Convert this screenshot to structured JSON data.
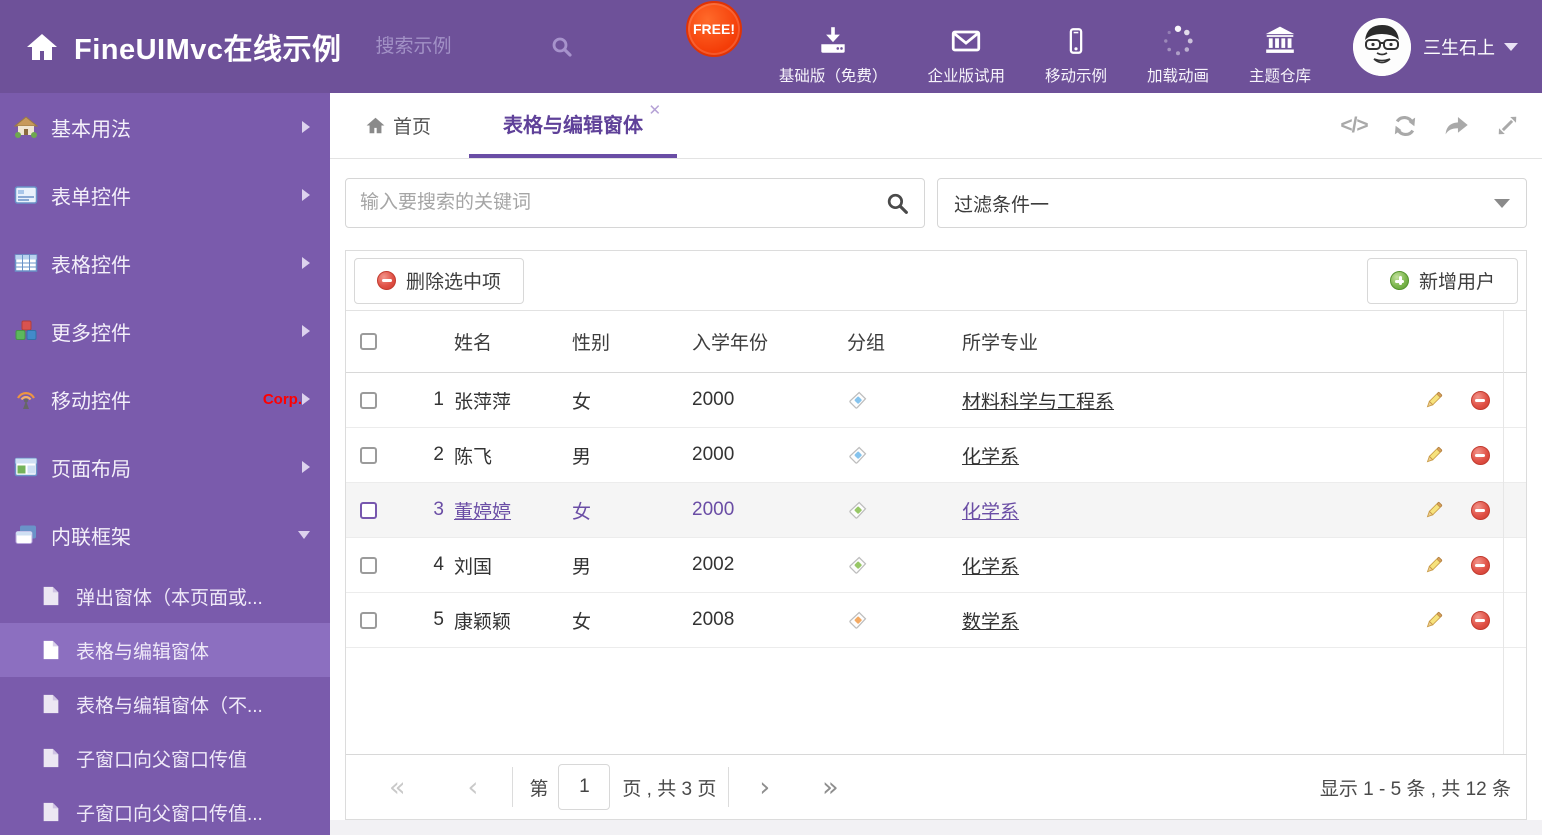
{
  "header": {
    "title": "FineUIMvc在线示例",
    "search_placeholder": "搜索示例",
    "free_badge": "FREE!",
    "nav": [
      {
        "label": "基础版（免费）",
        "icon": "download-icon"
      },
      {
        "label": "企业版试用",
        "icon": "envelope-icon"
      },
      {
        "label": "移动示例",
        "icon": "mobile-icon"
      },
      {
        "label": "加载动画",
        "icon": "spinner-icon"
      },
      {
        "label": "主题仓库",
        "icon": "bank-icon"
      }
    ],
    "user_name": "三生石上"
  },
  "sidebar": {
    "items": [
      {
        "label": "基本用法",
        "icon": "house-icon"
      },
      {
        "label": "表单控件",
        "icon": "form-icon"
      },
      {
        "label": "表格控件",
        "icon": "table-icon"
      },
      {
        "label": "更多控件",
        "icon": "cubes-icon"
      },
      {
        "label": "移动控件",
        "icon": "antenna-icon",
        "badge": "Corp."
      },
      {
        "label": "页面布局",
        "icon": "layout-icon"
      },
      {
        "label": "内联框架",
        "icon": "frames-icon"
      }
    ],
    "subitems": [
      "弹出窗体（本页面或...",
      "表格与编辑窗体",
      "表格与编辑窗体（不...",
      "子窗口向父窗口传值",
      "子窗口向父窗口传值..."
    ]
  },
  "tabs": {
    "home": "首页",
    "active": "表格与编辑窗体"
  },
  "filter_row": {
    "search_placeholder": "输入要搜索的关键词",
    "filter_value": "过滤条件一"
  },
  "grid": {
    "delete_button": "删除选中项",
    "add_button": "新增用户",
    "columns": {
      "name": "姓名",
      "gender": "性别",
      "year": "入学年份",
      "group": "分组",
      "major": "所学专业"
    },
    "rows": [
      {
        "num": "1",
        "name": "张萍萍",
        "gender": "女",
        "year": "2000",
        "tag_color": "#85c3ed",
        "major": "材料科学与工程系"
      },
      {
        "num": "2",
        "name": "陈飞",
        "gender": "男",
        "year": "2000",
        "tag_color": "#85c3ed",
        "major": "化学系"
      },
      {
        "num": "3",
        "name": "董婷婷",
        "gender": "女",
        "year": "2000",
        "tag_color": "#97c766",
        "major": "化学系",
        "selected": true
      },
      {
        "num": "4",
        "name": "刘国",
        "gender": "男",
        "year": "2002",
        "tag_color": "#97c766",
        "major": "化学系"
      },
      {
        "num": "5",
        "name": "康颖颖",
        "gender": "女",
        "year": "2008",
        "tag_color": "#f3a962",
        "major": "数学系"
      }
    ]
  },
  "pagination": {
    "label_prefix": "第",
    "page": "1",
    "label_suffix": "页 , 共 3 页",
    "summary": "显示 1 - 5 条 , 共 12 条"
  },
  "colors": {
    "header_bg": "#6e5199",
    "sidebar_bg": "#7a5bac",
    "sidebar_selected_bg": "#8c6fc0",
    "accent_purple": "#6a4da5",
    "free_badge": "#f43c07",
    "corp_badge": "#ff0000",
    "selected_row_bg": "#f5f5f5"
  }
}
